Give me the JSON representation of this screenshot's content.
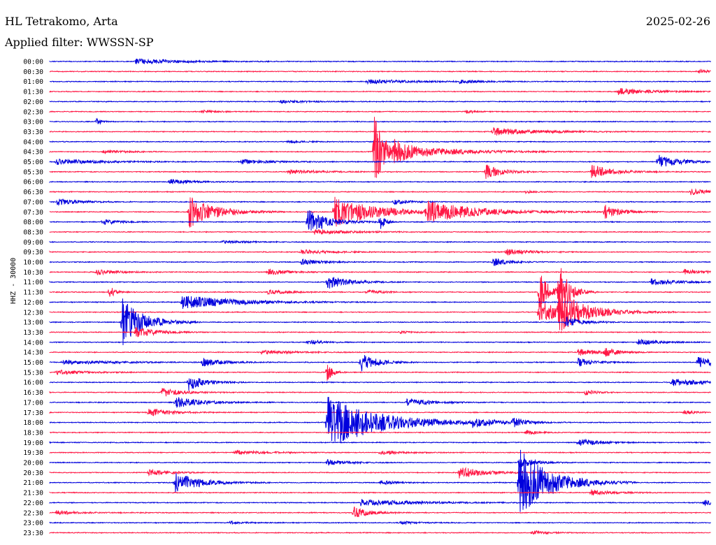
{
  "header": {
    "station": "HL Tetrakomo, Arta",
    "date": "2025-02-26",
    "filter": "Applied filter: WWSSN-SP"
  },
  "chart_data": {
    "type": "line",
    "ylabel": "HHZ - 30000",
    "colors": [
      "#0000dd",
      "#ff1744"
    ],
    "grid": false,
    "rows": [
      {
        "label": "00:00",
        "events": [
          [
            0.13,
            4,
            0.8
          ]
        ]
      },
      {
        "label": "00:30",
        "events": [
          [
            0.98,
            3,
            0.2
          ]
        ]
      },
      {
        "label": "01:00",
        "events": [
          [
            0.48,
            3,
            1.0
          ],
          [
            0.62,
            2,
            0.4
          ]
        ]
      },
      {
        "label": "01:30",
        "events": [
          [
            0.86,
            5,
            0.6
          ]
        ]
      },
      {
        "label": "02:00",
        "events": [
          [
            0.35,
            2,
            0.5
          ]
        ]
      },
      {
        "label": "02:30",
        "events": [
          [
            0.23,
            2,
            0.3
          ],
          [
            0.63,
            2,
            0.2
          ]
        ]
      },
      {
        "label": "03:00",
        "events": [
          [
            0.07,
            5,
            0.1
          ]
        ]
      },
      {
        "label": "03:30",
        "events": [
          [
            0.67,
            6,
            0.8
          ]
        ]
      },
      {
        "label": "04:00",
        "events": [
          [
            0.36,
            2,
            0.3
          ]
        ]
      },
      {
        "label": "04:30",
        "events": [
          [
            0.08,
            3,
            0.4
          ],
          [
            0.49,
            56,
            0.2
          ],
          [
            0.52,
            12,
            1.0
          ]
        ]
      },
      {
        "label": "05:00",
        "events": [
          [
            0.01,
            4,
            0.8
          ],
          [
            0.29,
            3,
            0.6
          ],
          [
            0.92,
            10,
            0.4
          ]
        ]
      },
      {
        "label": "05:30",
        "events": [
          [
            0.36,
            3,
            0.6
          ],
          [
            0.66,
            10,
            0.3
          ],
          [
            0.82,
            10,
            0.4
          ]
        ]
      },
      {
        "label": "06:00",
        "events": [
          [
            0.18,
            4,
            0.4
          ]
        ]
      },
      {
        "label": "06:30",
        "events": [
          [
            0.72,
            2,
            0.2
          ],
          [
            0.97,
            4,
            0.4
          ]
        ]
      },
      {
        "label": "07:00",
        "events": [
          [
            0.01,
            5,
            0.4
          ],
          [
            0.52,
            4,
            0.3
          ]
        ]
      },
      {
        "label": "07:30",
        "events": [
          [
            0.21,
            24,
            0.5
          ],
          [
            0.43,
            22,
            0.8
          ],
          [
            0.57,
            14,
            1.0
          ],
          [
            0.84,
            10,
            0.3
          ]
        ]
      },
      {
        "label": "08:00",
        "events": [
          [
            0.08,
            4,
            0.3
          ],
          [
            0.39,
            18,
            0.4
          ],
          [
            0.5,
            12,
            0.1
          ]
        ]
      },
      {
        "label": "08:30",
        "events": [
          [
            0.4,
            4,
            0.6
          ]
        ]
      },
      {
        "label": "09:00",
        "events": [
          [
            0.26,
            2,
            0.5
          ]
        ]
      },
      {
        "label": "09:30",
        "events": [
          [
            0.38,
            3,
            0.6
          ],
          [
            0.69,
            5,
            0.4
          ]
        ]
      },
      {
        "label": "10:00",
        "events": [
          [
            0.38,
            4,
            0.4
          ],
          [
            0.67,
            6,
            0.3
          ]
        ]
      },
      {
        "label": "10:30",
        "events": [
          [
            0.07,
            4,
            0.4
          ],
          [
            0.33,
            4,
            0.4
          ],
          [
            0.96,
            4,
            0.4
          ]
        ]
      },
      {
        "label": "11:00",
        "events": [
          [
            0.42,
            10,
            0.4
          ],
          [
            0.91,
            5,
            0.5
          ]
        ]
      },
      {
        "label": "11:30",
        "events": [
          [
            0.09,
            10,
            0.1
          ],
          [
            0.33,
            3,
            0.4
          ],
          [
            0.48,
            3,
            0.3
          ],
          [
            0.74,
            30,
            0.2
          ],
          [
            0.77,
            40,
            0.2
          ]
        ]
      },
      {
        "label": "12:00",
        "events": [
          [
            0.2,
            10,
            1.0
          ]
        ]
      },
      {
        "label": "12:30",
        "events": [
          [
            0.74,
            16,
            0.5
          ],
          [
            0.77,
            22,
            0.6
          ]
        ]
      },
      {
        "label": "13:00",
        "events": [
          [
            0.11,
            34,
            0.4
          ],
          [
            0.78,
            8,
            0.3
          ]
        ]
      },
      {
        "label": "13:30",
        "events": [
          [
            0.13,
            8,
            0.4
          ],
          [
            0.53,
            2,
            0.2
          ]
        ]
      },
      {
        "label": "14:00",
        "events": [
          [
            0.39,
            4,
            0.3
          ],
          [
            0.89,
            4,
            0.4
          ]
        ]
      },
      {
        "label": "14:30",
        "events": [
          [
            0.32,
            3,
            0.6
          ],
          [
            0.8,
            5,
            0.4
          ],
          [
            0.84,
            8,
            0.2
          ]
        ]
      },
      {
        "label": "15:00",
        "events": [
          [
            0.02,
            3,
            1.0
          ],
          [
            0.23,
            6,
            0.4
          ],
          [
            0.47,
            14,
            0.3
          ],
          [
            0.8,
            6,
            0.3
          ],
          [
            0.98,
            8,
            0.4
          ]
        ]
      },
      {
        "label": "15:30",
        "events": [
          [
            0.01,
            3,
            0.6
          ],
          [
            0.42,
            14,
            0.1
          ]
        ]
      },
      {
        "label": "16:00",
        "events": [
          [
            0.21,
            12,
            0.3
          ],
          [
            0.94,
            5,
            0.8
          ]
        ]
      },
      {
        "label": "16:30",
        "events": [
          [
            0.17,
            6,
            0.4
          ],
          [
            0.81,
            4,
            0.2
          ]
        ]
      },
      {
        "label": "17:00",
        "events": [
          [
            0.19,
            8,
            0.5
          ],
          [
            0.54,
            5,
            0.5
          ]
        ]
      },
      {
        "label": "17:30",
        "events": [
          [
            0.15,
            6,
            0.4
          ],
          [
            0.96,
            3,
            0.2
          ]
        ]
      },
      {
        "label": "18:00",
        "events": [
          [
            0.42,
            38,
            1.0
          ],
          [
            0.64,
            6,
            0.4
          ],
          [
            0.7,
            6,
            0.3
          ]
        ]
      },
      {
        "label": "18:30",
        "events": [
          [
            0.72,
            4,
            0.2
          ]
        ]
      },
      {
        "label": "19:00",
        "events": [
          [
            0.8,
            5,
            0.4
          ]
        ]
      },
      {
        "label": "19:30",
        "events": [
          [
            0.28,
            3,
            0.6
          ],
          [
            0.5,
            3,
            0.4
          ]
        ]
      },
      {
        "label": "20:00",
        "events": [
          [
            0.42,
            4,
            0.4
          ],
          [
            0.71,
            8,
            0.3
          ]
        ]
      },
      {
        "label": "20:30",
        "events": [
          [
            0.15,
            4,
            0.4
          ],
          [
            0.62,
            8,
            0.5
          ]
        ]
      },
      {
        "label": "21:00",
        "events": [
          [
            0.19,
            14,
            0.5
          ],
          [
            0.5,
            3,
            0.3
          ],
          [
            0.71,
            50,
            0.6
          ]
        ]
      },
      {
        "label": "21:30",
        "events": [
          [
            0.82,
            4,
            0.4
          ]
        ]
      },
      {
        "label": "22:00",
        "events": [
          [
            0.47,
            5,
            1.0
          ],
          [
            0.99,
            4,
            0.3
          ]
        ]
      },
      {
        "label": "22:30",
        "events": [
          [
            0.01,
            3,
            0.4
          ],
          [
            0.46,
            8,
            0.3
          ]
        ]
      },
      {
        "label": "23:00",
        "events": [
          [
            0.27,
            2,
            0.3
          ],
          [
            0.53,
            2,
            0.4
          ]
        ]
      },
      {
        "label": "23:30",
        "events": [
          [
            0.73,
            3,
            0.3
          ]
        ]
      }
    ]
  }
}
